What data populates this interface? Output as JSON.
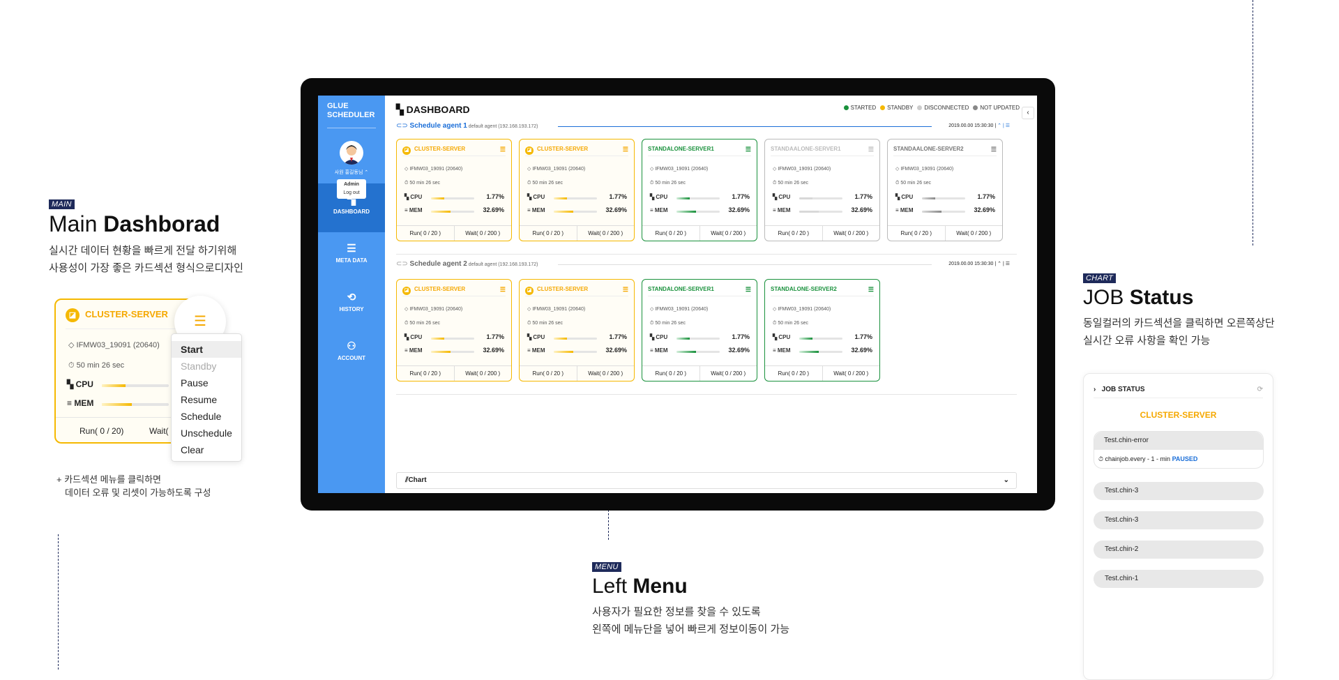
{
  "left_section": {
    "tag": "MAIN",
    "title_light": "Main ",
    "title_bold": "Dashborad",
    "desc1": "실시간 데이터 현황을 빠르게 전달 하기위해",
    "desc2": "사용성이 가장 좋은 카드섹션 형식으로디자인"
  },
  "zoom_card": {
    "name": "CLUSTER-SERVER",
    "id_line": "IFMW03_19091 (20640)",
    "time_line": "50 min 26 sec",
    "cpu": "CPU",
    "mem": "MEM",
    "run": "Run( 0 / 20)",
    "wait": "Wait(",
    "menu_items": [
      "Start",
      "Standby",
      "Pause",
      "Resume",
      "Schedule",
      "Unschedule",
      "Clear"
    ]
  },
  "left_note": {
    "line1": "+ 카드섹션 메뉴를 클릭하면",
    "line2": "데이터 오류 및 리셋이 가능하도록 구성"
  },
  "menu_section": {
    "tag": "MENU",
    "title_light": "Left ",
    "title_bold": "Menu",
    "desc1": "사용자가 필요한 정보를 찾을 수 있도록",
    "desc2": "왼쪽에 메뉴단을 넣어 빠르게 정보이동이 가능"
  },
  "chart_section": {
    "tag": "CHART",
    "title_light": "JOB ",
    "title_bold": "Status",
    "desc1": "동일컬러의 카드섹션을 클릭하면 오른쪽상단",
    "desc2": "실시간 오류 사항을 확인 가능"
  },
  "app": {
    "brand_line1": "GLUE",
    "brand_line2": "SCHEDULER",
    "user_name": "사원 홍길동님 ⌃",
    "user_menu": [
      "Admin",
      "Log out"
    ],
    "nav": [
      {
        "label": "DASHBOARD",
        "icon": "▚"
      },
      {
        "label": "META DATA",
        "icon": "☰"
      },
      {
        "label": "HISTORY",
        "icon": "⟲"
      },
      {
        "label": "ACCOUNT",
        "icon": "⚇"
      }
    ],
    "title": "DASHBOARD",
    "legend": [
      "STARTED",
      "STANDBY",
      "DISCONNECTED",
      "NOT UPDATED"
    ],
    "legend_colors": [
      "#19913c",
      "#f5b800",
      "#cccccc",
      "#888888"
    ],
    "agents": [
      {
        "name": "Schedule agent 1",
        "sub": "default agent (192.168.193.172)",
        "time": "2019.00.00  15:30:30  |",
        "icons": "⌃  |  ☰"
      },
      {
        "name": "Schedule agent 2",
        "sub": "default agent (192.168.193.172)",
        "time": "2019.00.00  15:30:30  |",
        "icons": "⌃  |  ☰"
      }
    ],
    "cards_row1": [
      {
        "name": "CLUSTER-SERVER",
        "status": "standby",
        "id": "◇ IFMW03_19091 (20640)",
        "time": "⏱ 50 min 26 sec",
        "cpu": "1.77%",
        "mem": "32.69%",
        "run": "Run( 0 / 20 )",
        "wait": "Wait( 0 / 200 )"
      },
      {
        "name": "CLUSTER-SERVER",
        "status": "standby",
        "id": "◇ IFMW03_19091 (20640)",
        "time": "⏱ 50 min 26 sec",
        "cpu": "1.77%",
        "mem": "32.69%",
        "run": "Run( 0 / 20 )",
        "wait": "Wait( 0 / 200 )"
      },
      {
        "name": "STANDALONE-SERVER1",
        "status": "started",
        "id": "◇ IFMW03_19091 (20640)",
        "time": "⏱ 50 min 26 sec",
        "cpu": "1.77%",
        "mem": "32.69%",
        "run": "Run( 0 / 20 )",
        "wait": "Wait( 0 / 200 )"
      },
      {
        "name": "STANDAALONE-SERVER1",
        "status": "disconnected",
        "id": "◇ IFMW03_19091 (20640)",
        "time": "⏱ 50 min 26 sec",
        "cpu": "1.77%",
        "mem": "32.69%",
        "run": "Run( 0 / 20 )",
        "wait": "Wait( 0 / 200 )"
      },
      {
        "name": "STANDAALONE-SERVER2",
        "status": "not-updated",
        "id": "◇ IFMW03_19091 (20640)",
        "time": "⏱ 50 min 26 sec",
        "cpu": "1.77%",
        "mem": "32.69%",
        "run": "Run( 0 / 20 )",
        "wait": "Wait( 0 / 200 )"
      }
    ],
    "cards_row2": [
      {
        "name": "CLUSTER-SERVER",
        "status": "standby",
        "id": "◇ IFMW03_19091 (20640)",
        "time": "⏱ 50 min 26 sec",
        "cpu": "1.77%",
        "mem": "32.69%",
        "run": "Run( 0 / 20 )",
        "wait": "Wait( 0 / 200 )"
      },
      {
        "name": "CLUSTER-SERVER",
        "status": "standby",
        "id": "◇ IFMW03_19091 (20640)",
        "time": "⏱ 50 min 26 sec",
        "cpu": "1.77%",
        "mem": "32.69%",
        "run": "Run( 0 / 20 )",
        "wait": "Wait( 0 / 200 )"
      },
      {
        "name": "STANDALONE-SERVER1",
        "status": "started",
        "id": "◇ IFMW03_19091 (20640)",
        "time": "⏱ 50 min 26 sec",
        "cpu": "1.77%",
        "mem": "32.69%",
        "run": "Run( 0 / 20 )",
        "wait": "Wait( 0 / 200 )"
      },
      {
        "name": "STANDALONE-SERVER2",
        "status": "started",
        "id": "◇ IFMW03_19091 (20640)",
        "time": "⏱ 50 min 26 sec",
        "cpu": "1.77%",
        "mem": "32.69%",
        "run": "Run( 0 / 20 )",
        "wait": "Wait( 0 / 200 )"
      }
    ],
    "chart_label": "⫽Chart"
  },
  "job_status": {
    "title": "JOB STATUS",
    "server": "CLUSTER-SERVER",
    "first": "Test.chin-error",
    "first_detail": "⏱ chainjob.every - 1 - min",
    "first_state": "PAUSED",
    "items": [
      "Test.chin-3",
      "Test.chin-3",
      "Test.chin-2",
      "Test.chin-1"
    ]
  }
}
